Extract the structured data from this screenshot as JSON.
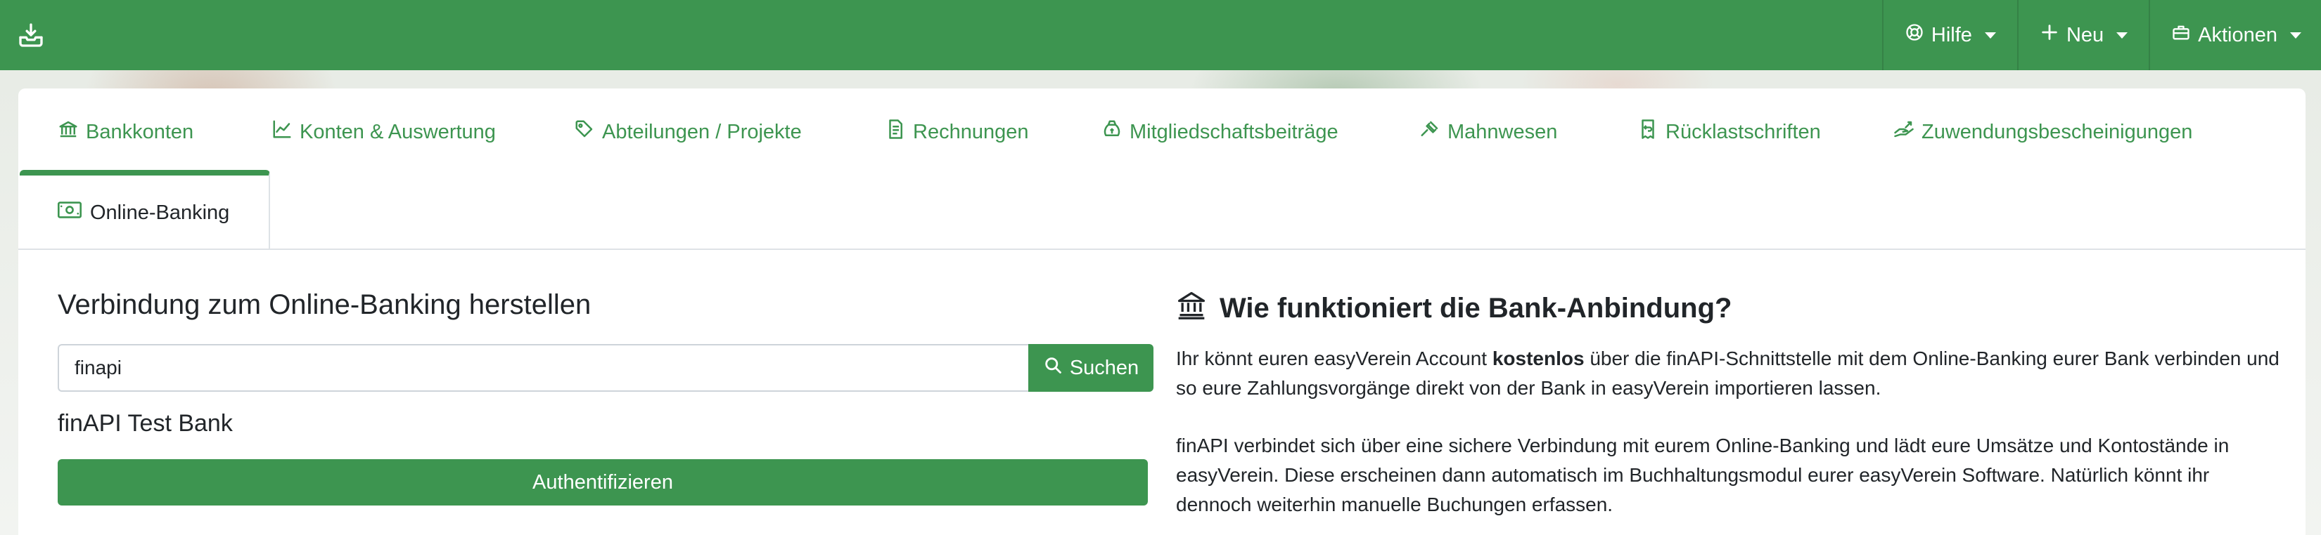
{
  "navbar": {
    "brand_icon": "inbox-download-icon",
    "items": [
      {
        "label": "Hilfe",
        "icon": "lifebuoy-icon"
      },
      {
        "label": "Neu",
        "icon": "plus-icon"
      },
      {
        "label": "Aktionen",
        "icon": "toolbox-icon"
      }
    ]
  },
  "tabs": [
    {
      "label": "Bankkonten",
      "icon": "bank-icon"
    },
    {
      "label": "Konten & Auswertung",
      "icon": "chart-line-icon"
    },
    {
      "label": "Abteilungen / Projekte",
      "icon": "tags-icon"
    },
    {
      "label": "Rechnungen",
      "icon": "invoice-icon"
    },
    {
      "label": "Mitgliedschaftsbeiträge",
      "icon": "money-bag-icon"
    },
    {
      "label": "Mahnwesen",
      "icon": "gavel-icon"
    },
    {
      "label": "Rücklastschriften",
      "icon": "receipt-return-icon"
    },
    {
      "label": "Zuwendungsbescheinigungen",
      "icon": "hand-donation-icon"
    }
  ],
  "active_tab": {
    "label": "Online-Banking",
    "icon": "banknote-icon"
  },
  "connect": {
    "title": "Verbindung zum Online-Banking herstellen",
    "search_value": "finapi",
    "search_button": "Suchen",
    "bank_name": "finAPI Test Bank",
    "auth_button": "Authentifizieren"
  },
  "info": {
    "title": "Wie funktioniert die Bank-Anbindung?",
    "p1_before": "Ihr könnt euren easyVerein Account ",
    "p1_bold": "kostenlos",
    "p1_after": " über die finAPI-Schnittstelle mit dem Online-Banking eurer Bank verbinden und so eure Zahlungsvorgänge direkt von der Bank in easyVerein importieren lassen.",
    "p2": "finAPI verbindet sich über eine sichere Verbindung mit eurem Online-Banking und lädt eure Umsätze und Kontostände in easyVerein. Diese erscheinen dann automatisch im Buchhaltungsmodul eurer easyVerein Software. Natürlich könnt ihr dennoch weiterhin manuelle Buchungen erfassen."
  },
  "colors": {
    "brand": "#3d9550",
    "text": "#212529",
    "border": "#dee2e6"
  }
}
